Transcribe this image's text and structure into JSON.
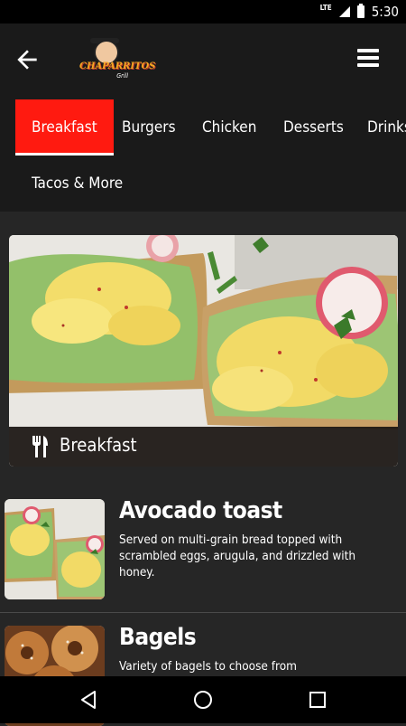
{
  "status": {
    "network": "LTE",
    "time": "5:30"
  },
  "header": {
    "logo_text": "CHAPARRITOS",
    "logo_sub": "Grill"
  },
  "tabs": [
    {
      "label": "Breakfast",
      "active": true
    },
    {
      "label": "Burgers"
    },
    {
      "label": "Chicken"
    },
    {
      "label": "Desserts"
    },
    {
      "label": "Drinks"
    },
    {
      "label": "Tacos & More"
    }
  ],
  "featured": {
    "title": "Breakfast",
    "icon": "utensils-icon"
  },
  "items": [
    {
      "title": "Avocado toast",
      "description": "Served on multi-grain bread topped with scrambled eggs, arugula, and drizzled with honey."
    },
    {
      "title": "Bagels",
      "description": "Variety of bagels to choose from"
    }
  ],
  "colors": {
    "accent": "#ff1a10",
    "background": "#262626",
    "bar": "#1a1a1a"
  }
}
